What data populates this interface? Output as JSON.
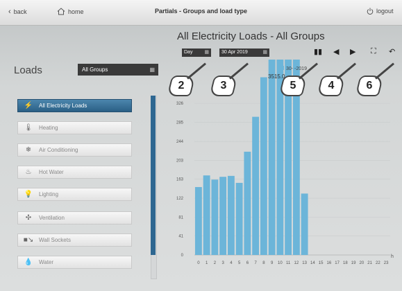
{
  "topbar": {
    "back_label": "back",
    "home_label": "home",
    "title": "Partials - Groups and load type",
    "logout_label": "logout"
  },
  "page_title": "All Electricity Loads - All Groups",
  "loads_title": "Loads",
  "group_select": {
    "value": "All Groups"
  },
  "loads": [
    {
      "label": "All Electricity Loads",
      "icon": "lightning-icon",
      "active": true
    },
    {
      "label": "Heating",
      "icon": "thermometer-icon",
      "active": false
    },
    {
      "label": "Air Conditioning",
      "icon": "snowflake-icon",
      "active": false
    },
    {
      "label": "Hot Water",
      "icon": "hot-water-icon",
      "active": false
    },
    {
      "label": "Lighting",
      "icon": "lamp-icon",
      "active": false
    },
    {
      "label": "Ventilation",
      "icon": "fan-icon",
      "active": false
    },
    {
      "label": "Wall Sockets",
      "icon": "plug-icon",
      "active": false
    },
    {
      "label": "Water",
      "icon": "water-drop-icon",
      "active": false
    }
  ],
  "controls": {
    "period_value": "Day",
    "date_value": "30 Apr 2019"
  },
  "callouts": [
    "2",
    "3",
    "5",
    "4",
    "6"
  ],
  "tooltip": {
    "date": "30-   -2019",
    "value": "3515.0"
  },
  "colors": {
    "accent": "#2e6791",
    "bar": "#6cb5d9",
    "active_button": "#356f98"
  },
  "chart_data": {
    "type": "bar",
    "categories": [
      "0",
      "1",
      "2",
      "3",
      "4",
      "5",
      "6",
      "7",
      "8",
      "9",
      "10",
      "11",
      "12",
      "13",
      "14",
      "15",
      "16",
      "17",
      "18",
      "19",
      "20",
      "21",
      "22",
      "23"
    ],
    "values": [
      146,
      171,
      162,
      168,
      170,
      155,
      222,
      297,
      382,
      420,
      420,
      420,
      420,
      132,
      0,
      0,
      0,
      0,
      0,
      0,
      0,
      0,
      0,
      0
    ],
    "ylim": [
      0,
      420
    ],
    "yticks": [
      "0",
      "41",
      "81",
      "122",
      "163",
      "203",
      "244",
      "285",
      "326"
    ],
    "xlabel": "h",
    "legend": "30-   -2019",
    "grid": true
  }
}
